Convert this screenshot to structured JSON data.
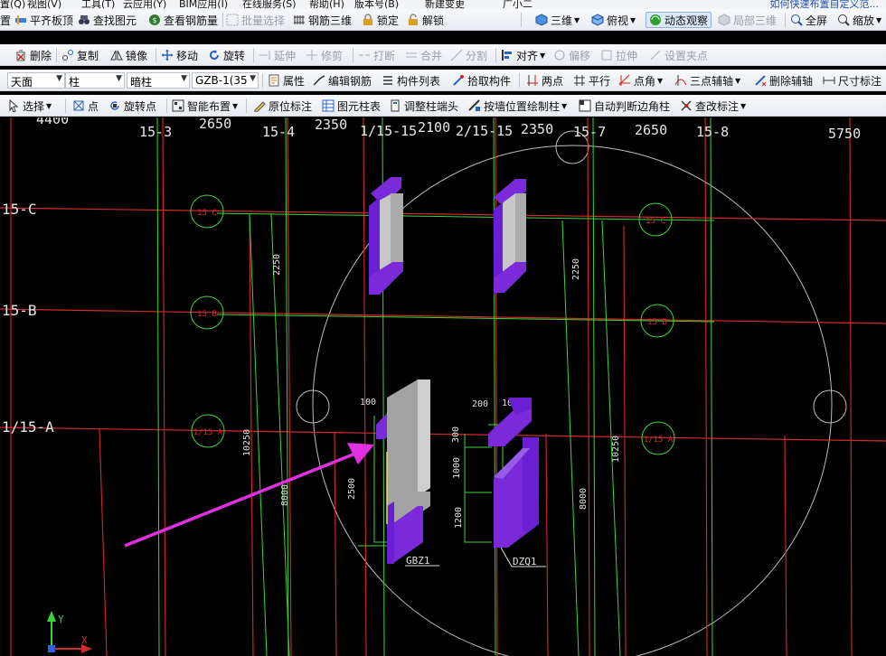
{
  "menubar": {
    "items": [
      "置(Q)",
      "视图(V)",
      "工具(T)",
      "云应用(Y)",
      "BIM应用(I)",
      "在线服务(S)",
      "帮助(H)",
      "版本号(B)",
      "新建变更",
      "广小二"
    ],
    "help_link": "如何快速布置自定义范..."
  },
  "toolbar1": {
    "items": [
      "置",
      "平齐板顶",
      "查找图元",
      "查看钢筋量",
      "批量选择",
      "钢筋三维",
      "锁定",
      "解锁",
      "三维",
      "俯视",
      "动态观察",
      "局部三维",
      "全屏",
      "缩放"
    ]
  },
  "toolbar2": {
    "items": [
      "删除",
      "复制",
      "镜像",
      "移动",
      "旋转",
      "延伸",
      "修剪",
      "打断",
      "合并",
      "分割",
      "对齐",
      "偏移",
      "拉伸",
      "设置夹点"
    ]
  },
  "toolbar3": {
    "combo_floor": "天面",
    "combo_type": "柱",
    "combo_subtype": "暗柱",
    "combo_element": "GZB-1(35",
    "items": [
      "属性",
      "编辑钢筋",
      "构件列表",
      "拾取构件",
      "两点",
      "平行",
      "点角",
      "三点辅轴",
      "删除辅轴",
      "尺寸标注"
    ]
  },
  "toolbar4": {
    "items": [
      "选择",
      "点",
      "旋转点",
      "智能布置",
      "原位标注",
      "图元柱表",
      "调整柱端头",
      "按墙位置绘制柱",
      "自动判断边角柱",
      "查改标注"
    ]
  },
  "canvas": {
    "top_dims": [
      "4400",
      "2650",
      "2350",
      "2100",
      "2350",
      "2650",
      "5750"
    ],
    "axis_labels_top": [
      "15-3",
      "15-4",
      "1/15-15",
      "2/15-15",
      "15-7",
      "15-8"
    ],
    "row_labels": [
      "15-C",
      "15-B",
      "1/15-A"
    ],
    "bubble_labels": [
      "15 C",
      "15 B",
      "1/15 A"
    ],
    "vertical_dims": [
      "2250",
      "2250",
      "10250",
      "10250",
      "8000",
      "8000",
      "2500"
    ],
    "detail_dims": [
      "100",
      "200",
      "100",
      "300",
      "1000",
      "1200"
    ],
    "element_labels": [
      "GBZ1",
      "DZQ1"
    ],
    "ucs": {
      "y": "Y",
      "x": "X"
    }
  },
  "colors": {
    "grid_red": "#d42a2a",
    "grid_green": "#3cd43c",
    "column_purple": "#6a1fd4",
    "column_gray": "#9c9c9c",
    "arrow": "#e12fe1"
  }
}
